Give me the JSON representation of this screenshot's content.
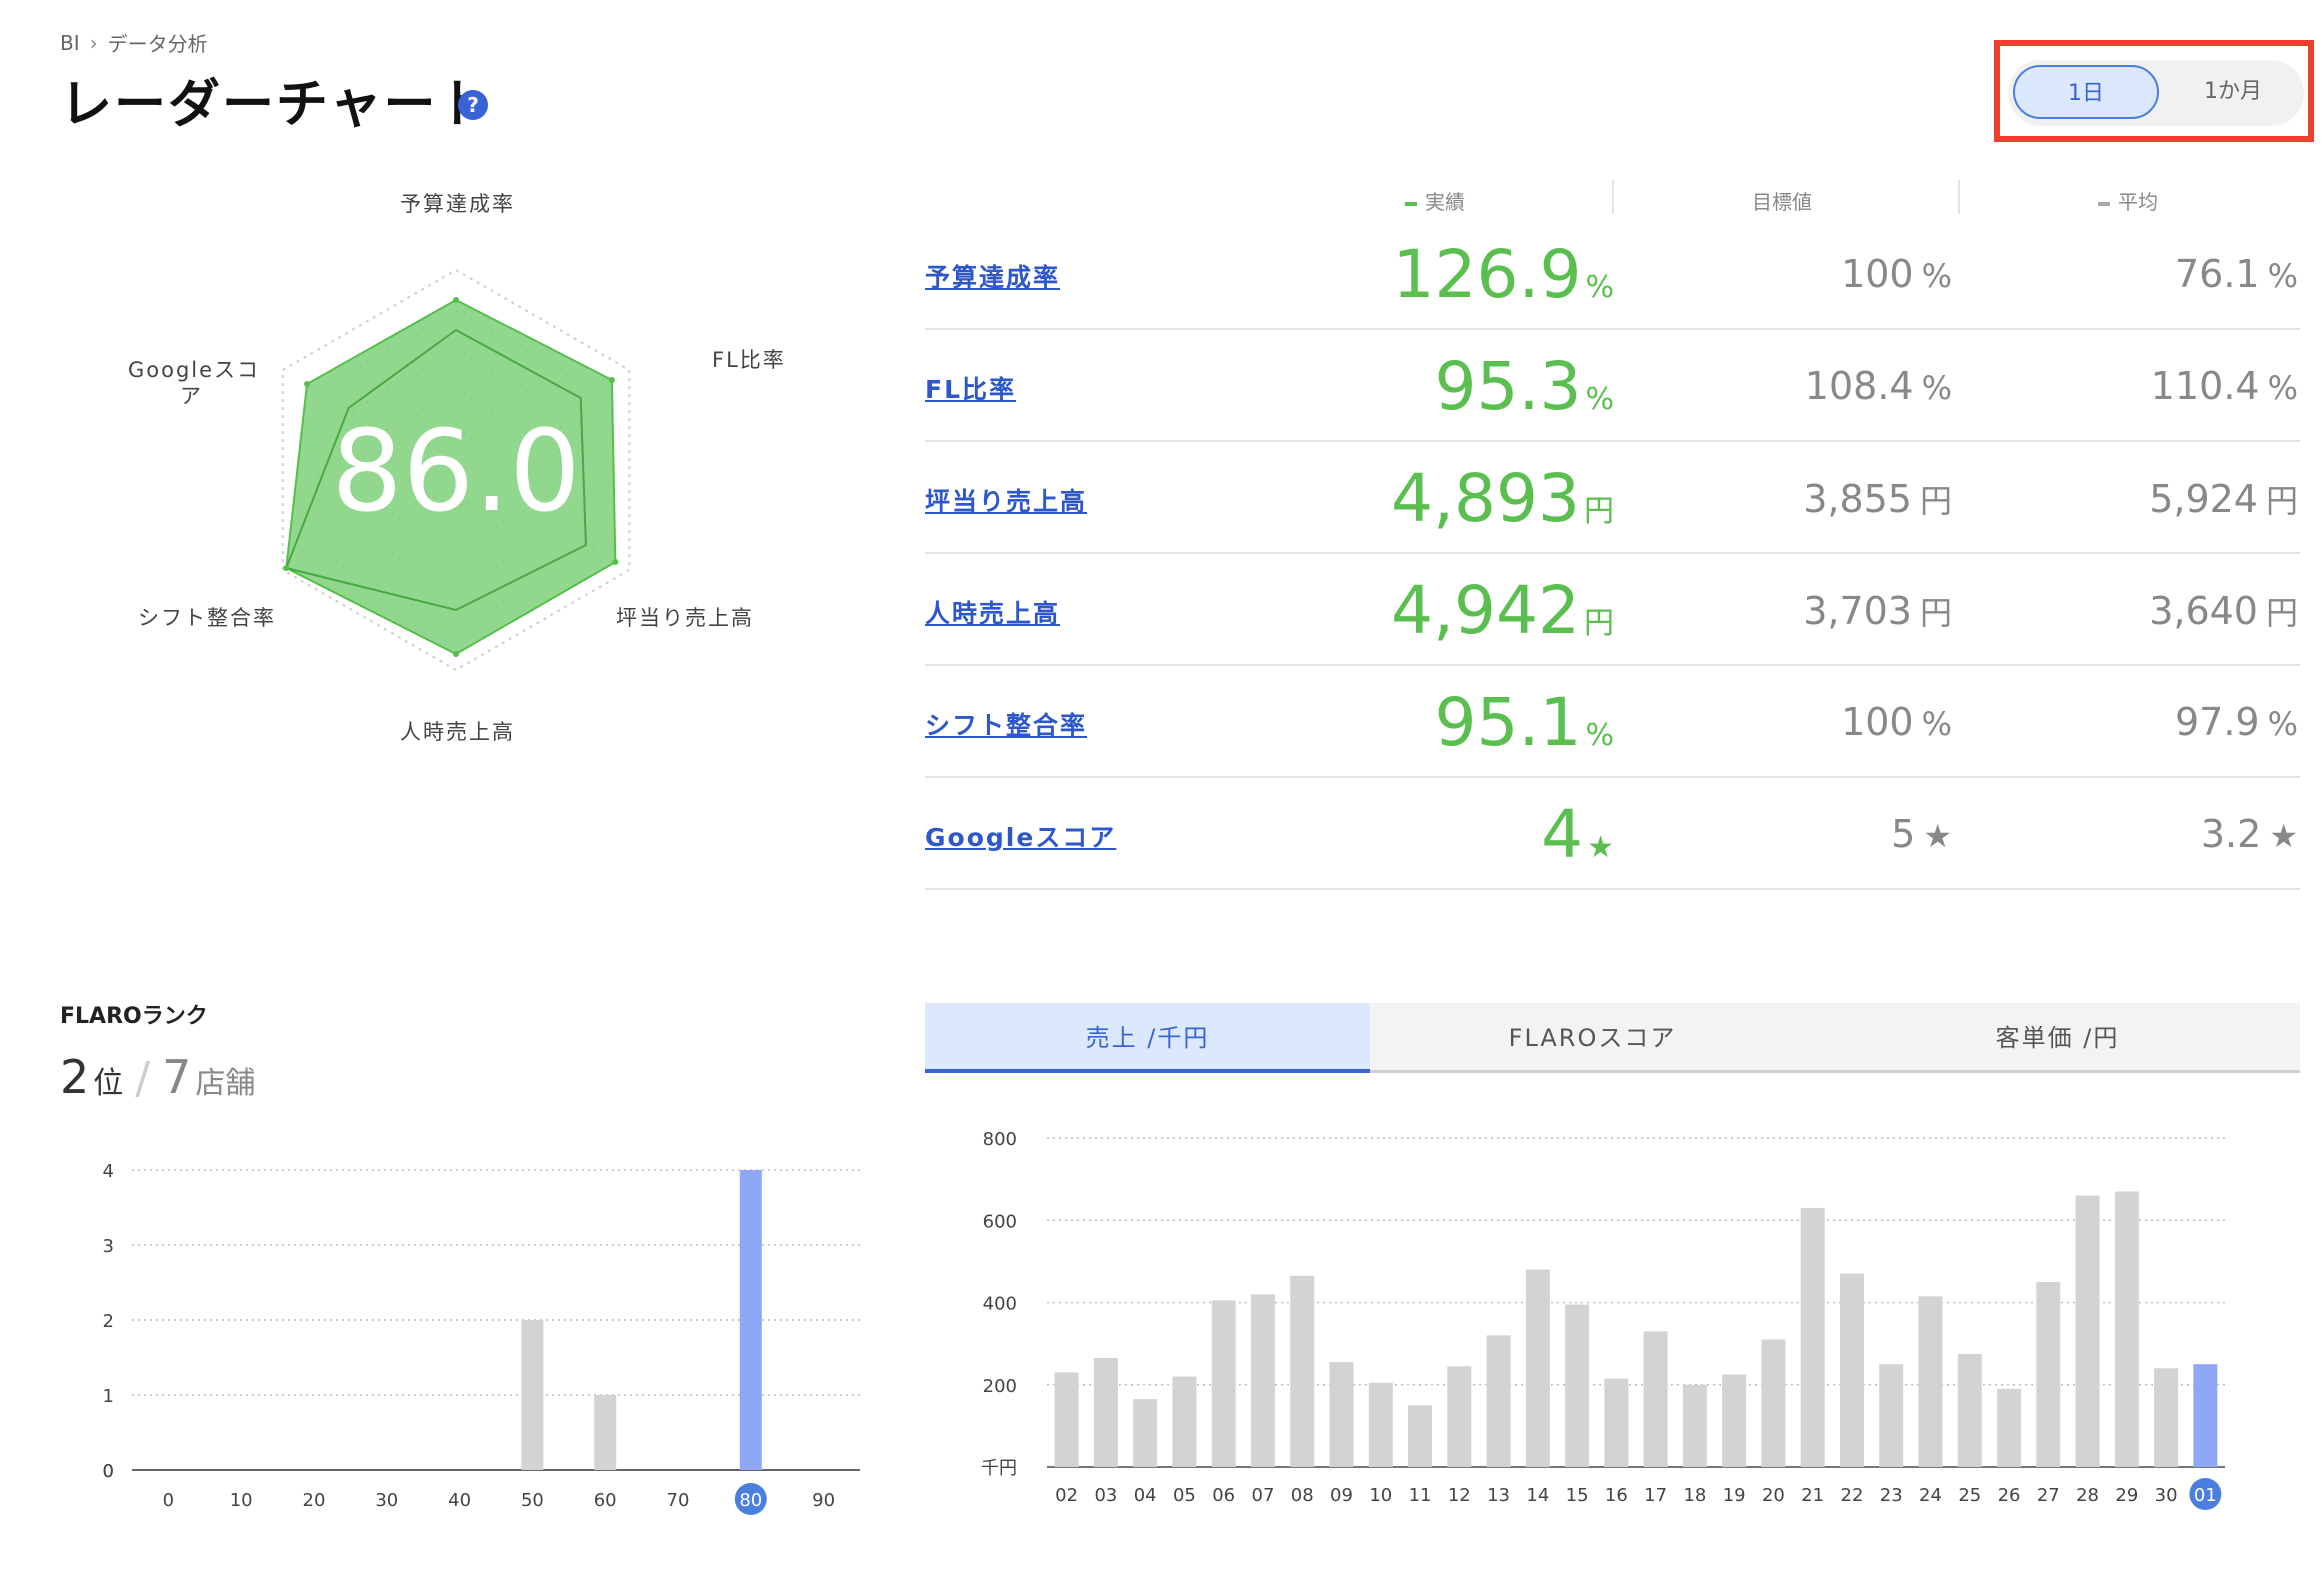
{
  "breadcrumb": {
    "root": "BI",
    "separator": "›",
    "current": "データ分析"
  },
  "title": "レーダーチャート",
  "help_icon": "?",
  "period_toggle": {
    "options": [
      "1日",
      "1か月"
    ],
    "selected": "1日"
  },
  "radar": {
    "score": "86.0",
    "axes": [
      "予算達成率",
      "FL比率",
      "坪当り売上高",
      "人時売上高",
      "シフト整合率",
      "Googleスコア"
    ],
    "labels": {
      "google_line1": "Googleスコ",
      "google_line2": "ア"
    },
    "actual": [
      0.85,
      0.9,
      0.92,
      0.92,
      0.98,
      0.86
    ],
    "average": [
      0.7,
      0.72,
      0.75,
      0.7,
      0.98,
      0.62
    ],
    "colors": {
      "fill": "#7fd07a",
      "stroke": "#55bf4b",
      "avg_stroke": "#4aa843"
    }
  },
  "metrics": {
    "headers": {
      "actual": "実績",
      "target": "目標値",
      "average": "平均"
    },
    "rows": [
      {
        "label": "予算達成率",
        "actual": "126.9",
        "actual_unit": "%",
        "target": "100",
        "target_unit": "%",
        "average": "76.1",
        "average_unit": "%"
      },
      {
        "label": "FL比率",
        "actual": "95.3",
        "actual_unit": "%",
        "target": "108.4",
        "target_unit": "%",
        "average": "110.4",
        "average_unit": "%"
      },
      {
        "label": "坪当り売上高",
        "actual": "4,893",
        "actual_unit": "円",
        "target": "3,855",
        "target_unit": "円",
        "average": "5,924",
        "average_unit": "円"
      },
      {
        "label": "人時売上高",
        "actual": "4,942",
        "actual_unit": "円",
        "target": "3,703",
        "target_unit": "円",
        "average": "3,640",
        "average_unit": "円"
      },
      {
        "label": "シフト整合率",
        "actual": "95.1",
        "actual_unit": "%",
        "target": "100",
        "target_unit": "%",
        "average": "97.9",
        "average_unit": "%"
      },
      {
        "label": "Googleスコア",
        "actual": "4",
        "actual_unit": "★",
        "target": "5",
        "target_unit": "★",
        "average": "3.2",
        "average_unit": "★"
      }
    ],
    "colors": {
      "actual": "#5bbf4f",
      "link": "#2e58c9"
    }
  },
  "rank": {
    "title": "FLAROランク",
    "position": "2",
    "position_unit": "位",
    "slash": "/",
    "total": "7",
    "total_unit": "店舗"
  },
  "tabs": {
    "sales": "売上 /千円",
    "flaro": "FLAROスコア",
    "unit_price": "客単価 /円",
    "selected": "sales"
  },
  "chart_data": [
    {
      "type": "bar",
      "categories": [
        "0",
        "10",
        "20",
        "30",
        "40",
        "50",
        "60",
        "70",
        "80",
        "90"
      ],
      "values": [
        0,
        0,
        0,
        0,
        0,
        2,
        1,
        0,
        4,
        0
      ],
      "highlight_category": "80",
      "ylim": [
        0,
        4
      ],
      "yticks": [
        0,
        1,
        2,
        3,
        4
      ],
      "grid": true,
      "colors": {
        "bar": "#d3d3d3",
        "highlight": "#8fa8f5"
      }
    },
    {
      "type": "bar",
      "categories": [
        "02",
        "03",
        "04",
        "05",
        "06",
        "07",
        "08",
        "09",
        "10",
        "11",
        "12",
        "13",
        "14",
        "15",
        "16",
        "17",
        "18",
        "19",
        "20",
        "21",
        "22",
        "23",
        "24",
        "25",
        "26",
        "27",
        "28",
        "29",
        "30",
        "01"
      ],
      "values": [
        230,
        265,
        165,
        220,
        405,
        420,
        465,
        255,
        205,
        150,
        245,
        320,
        480,
        395,
        215,
        330,
        200,
        225,
        310,
        630,
        470,
        250,
        415,
        275,
        190,
        450,
        660,
        670,
        240,
        250
      ],
      "highlight_category": "01",
      "ylim": [
        0,
        800
      ],
      "yticks": [
        200,
        400,
        600,
        800
      ],
      "ylabel": "千円",
      "grid": true,
      "colors": {
        "bar": "#d3d3d3",
        "highlight": "#8fa8f5"
      }
    }
  ]
}
